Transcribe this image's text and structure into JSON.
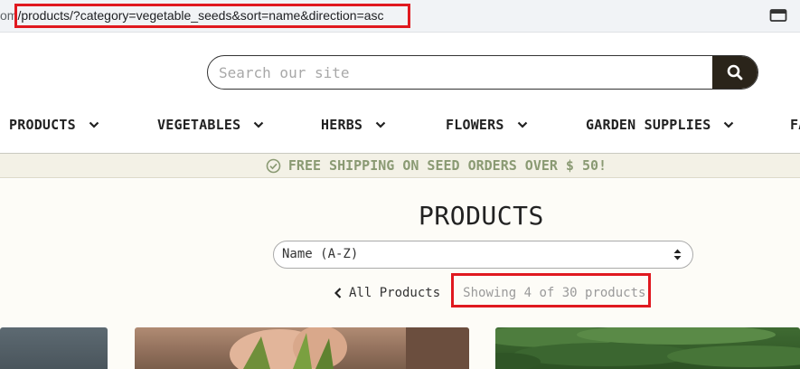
{
  "browser": {
    "url_prefix": "om",
    "url_path": "/products/?category=vegetable_seeds&sort=name&direction=asc"
  },
  "header": {
    "search_placeholder": "Search our site",
    "nav": [
      {
        "label": "PRODUCTS"
      },
      {
        "label": "VEGETABLES"
      },
      {
        "label": "HERBS"
      },
      {
        "label": "FLOWERS"
      },
      {
        "label": "GARDEN SUPPLIES"
      },
      {
        "label": "FA"
      }
    ]
  },
  "banner": {
    "text": "FREE SHIPPING ON SEED ORDERS OVER $ 50!"
  },
  "main": {
    "title": "PRODUCTS",
    "sort_selected": "Name (A-Z)",
    "all_products_label": "All Products",
    "showing_text": "Showing 4 of 30 products"
  },
  "colors": {
    "accent_dark": "#2a241a",
    "banner_text": "#8a9a73",
    "highlight_box": "#e0191f"
  }
}
